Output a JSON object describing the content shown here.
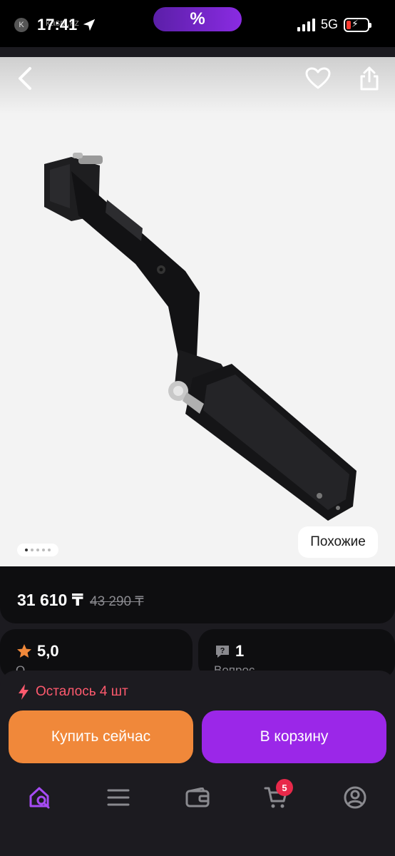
{
  "status_bar": {
    "time": "17:41",
    "watermark": "kaspi.kz",
    "promo_symbol": "%",
    "network": "5G"
  },
  "gallery": {
    "back_icon": "chevron-left-icon",
    "favorite_icon": "heart-icon",
    "share_icon": "share-icon",
    "similar_label": "Похожие",
    "pages_total": 5,
    "page_active": 1
  },
  "price": {
    "current": "31 610 ₸",
    "old": "43 290 ₸"
  },
  "rating": {
    "value": "5,0",
    "sub": "О..."
  },
  "questions": {
    "value": "1",
    "sub": "Вопрос"
  },
  "stock": {
    "text": "Осталось 4 шт"
  },
  "actions": {
    "buy_now": "Купить сейчас",
    "add_to_cart": "В корзину"
  },
  "tabbar": {
    "items": [
      {
        "name": "home-search",
        "icon": "home-search-icon"
      },
      {
        "name": "catalog",
        "icon": "menu-icon"
      },
      {
        "name": "wallet",
        "icon": "wallet-icon"
      },
      {
        "name": "cart",
        "icon": "cart-icon"
      },
      {
        "name": "profile",
        "icon": "profile-icon"
      }
    ],
    "cart_badge": "5"
  },
  "colors": {
    "accent_purple": "#9b27e8",
    "accent_orange": "#f0883a",
    "stock_red": "#ff5a6e",
    "badge_red": "#e8294a"
  }
}
